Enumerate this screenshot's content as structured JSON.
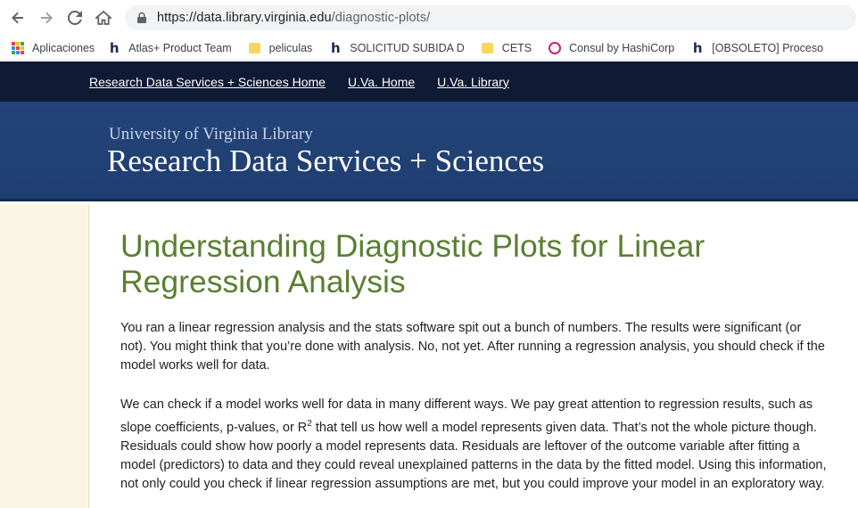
{
  "browser": {
    "url_host": "https://data.library.virginia.edu",
    "url_path": "/diagnostic-plots/",
    "bookmarks": [
      {
        "label": "Aplicaciones",
        "icon": "apps-grid-icon"
      },
      {
        "label": "Atlas+ Product Team",
        "icon": "h-icon"
      },
      {
        "label": "peliculas",
        "icon": "folder-icon"
      },
      {
        "label": "SOLICITUD SUBIDA D",
        "icon": "h-icon"
      },
      {
        "label": "CETS",
        "icon": "folder-icon"
      },
      {
        "label": "Consul by HashiCorp",
        "icon": "consul-icon"
      },
      {
        "label": "[OBSOLETO] Proceso",
        "icon": "h-icon"
      }
    ]
  },
  "site_nav": {
    "items": [
      "Research Data Services + Sciences Home",
      "U.Va. Home",
      "U.Va. Library"
    ]
  },
  "banner": {
    "small": "University of Virginia Library",
    "big": "Research Data Services + Sciences"
  },
  "article": {
    "title": "Understanding Diagnostic Plots for Linear Regression Analysis",
    "p1": "You ran a linear regression analysis and the stats software spit out a bunch of numbers. The results were significant (or not). You might think that you’re done with analysis. No, not yet. After running a regression analysis, you should check if the model works well for data.",
    "p2_before": "We can check if a model works well for data in many different ways. We pay great attention to regression results, such as slope coefficients, p-values, or R",
    "p2_sup": "2",
    "p2_after": " that tell us how well a model represents given data. That’s not the whole picture though. Residuals could show how poorly a model represents data. Residuals are leftover of the outcome variable after fitting a model (predictors) to data and they could reveal unexplained patterns in the data by the fitted model. Using this information, not only could you check if linear regression assumptions are met, but you could improve your model in an exploratory way."
  },
  "colors": {
    "nav_bg": "#0f1a34",
    "banner_bg": "#24457a",
    "title_green": "#5a7f31",
    "sidebar_bg": "#fbf6e3"
  }
}
